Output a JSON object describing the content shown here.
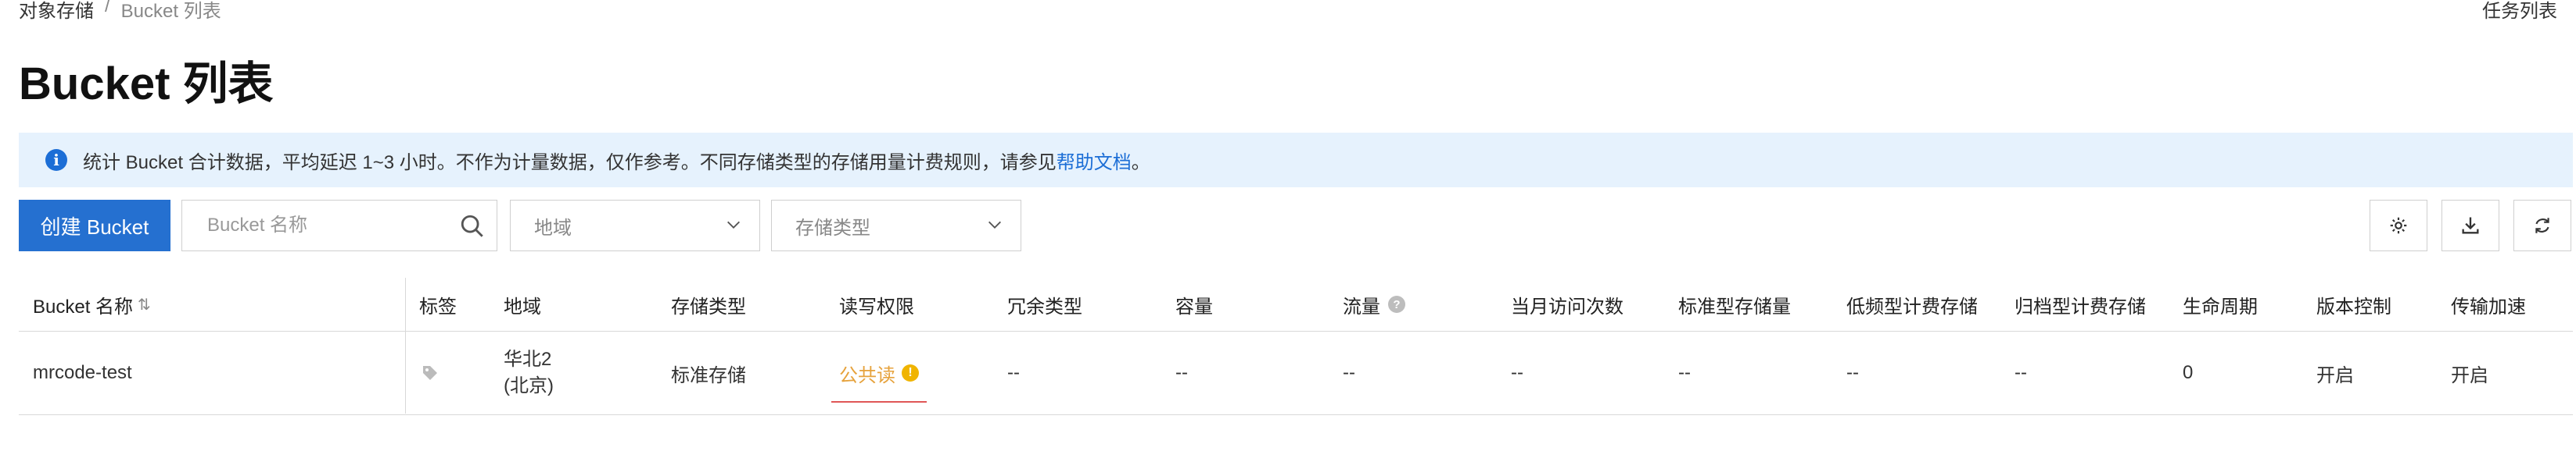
{
  "breadcrumb": {
    "root": "对象存储",
    "separator": "/",
    "current": "Bucket 列表"
  },
  "header": {
    "task_list": "任务列表"
  },
  "page_title": "Bucket 列表",
  "notice": {
    "text": "统计 Bucket 合计数据，平均延迟 1~3 小时。不作为计量数据，仅作参考。不同存储类型的存储用量计费规则，请参见",
    "link": "帮助文档",
    "suffix": "。"
  },
  "toolbar": {
    "create_label": "创建 Bucket",
    "search_placeholder": "Bucket 名称",
    "region_placeholder": "地域",
    "storage_placeholder": "存储类型"
  },
  "table": {
    "columns": [
      "Bucket 名称",
      "标签",
      "地域",
      "存储类型",
      "读写权限",
      "冗余类型",
      "容量",
      "流量",
      "当月访问次数",
      "标准型存储量",
      "低频型计费存储",
      "归档型计费存储",
      "生命周期",
      "版本控制",
      "传输加速"
    ],
    "rows": [
      {
        "name": "mrcode-test",
        "region_line1": "华北2",
        "region_line2": "(北京)",
        "storage_type": "标准存储",
        "acl": "公共读",
        "redundancy": "--",
        "capacity": "--",
        "traffic": "--",
        "monthly_visits": "--",
        "standard_storage": "--",
        "ia_storage": "--",
        "archive_storage": "--",
        "lifecycle": "0",
        "versioning": "开启",
        "transfer_acceleration": "开启"
      }
    ]
  },
  "colors": {
    "primary": "#2570d0",
    "link": "#1c6ed6",
    "notice_bg": "#e6f2fd",
    "warning": "#e6a23c"
  }
}
